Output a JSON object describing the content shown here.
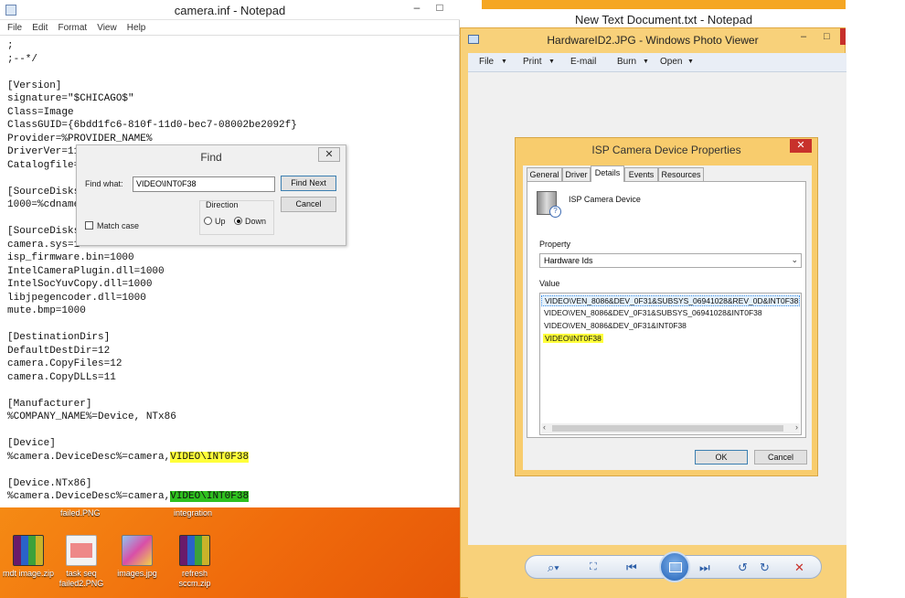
{
  "notepad": {
    "title": "camera.inf - Notepad",
    "menu": [
      "File",
      "Edit",
      "Format",
      "View",
      "Help"
    ],
    "lines": [
      ";",
      ";--*/",
      "",
      "[Version]",
      "signature=\"$CHICAGO$\"",
      "Class=Image",
      "ClassGUID={6bdd1fc6-810f-11d0-bec7-08002be2092f}",
      "Provider=%PROVIDER_NAME%",
      "DriverVer=11",
      "Catalogfile=",
      "",
      "[SourceDisks",
      "1000=%cdname",
      "",
      "[SourceDisks",
      "camera.sys=1",
      "isp_firmware.bin=1000",
      "IntelCameraPlugin.dll=1000",
      "IntelSocYuvCopy.dll=1000",
      "libjpegencoder.dll=1000",
      "mute.bmp=1000",
      "",
      "[DestinationDirs]",
      "DefaultDestDir=12",
      "camera.CopyFiles=12",
      "camera.CopyDLLs=11",
      "",
      "[Manufacturer]",
      "%COMPANY_NAME%=Device, NTx86",
      "",
      "[Device]"
    ],
    "device_line_prefix": "%camera.DeviceDesc%=camera,",
    "device_line_value": "VIDEO\\INT0F38",
    "blank": "",
    "ntx86_header": "[Device.NTx86]",
    "ntx86_line_prefix": "%camera.DeviceDesc%=camera,",
    "ntx86_line_value": "VIDEO\\INT0F38"
  },
  "find_dialog": {
    "title": "Find",
    "close": "✕",
    "find_what_label": "Find what:",
    "find_what_value": "VIDEO\\INT0F38",
    "find_next": "Find Next",
    "cancel": "Cancel",
    "direction_label": "Direction",
    "up": "Up",
    "down": "Down",
    "match_case": "Match case"
  },
  "background_notepad": {
    "title": "New Text Document.txt - Notepad"
  },
  "photo_viewer": {
    "title": "HardwareID2.JPG - Windows Photo Viewer",
    "toolbar": [
      "File",
      "Print",
      "E-mail",
      "Burn",
      "Open"
    ]
  },
  "properties": {
    "title": "ISP Camera Device Properties",
    "close": "✕",
    "tabs": [
      "General",
      "Driver",
      "Details",
      "Events",
      "Resources"
    ],
    "device_name": "ISP Camera Device",
    "property_label": "Property",
    "property_value": "Hardware Ids",
    "value_label": "Value",
    "values": [
      "VIDEO\\VEN_8086&DEV_0F31&SUBSYS_06941028&REV_0D&INT0F38",
      "VIDEO\\VEN_8086&DEV_0F31&SUBSYS_06941028&INT0F38",
      "VIDEO\\VEN_8086&DEV_0F31&INT0F38",
      "VIDEO\\INT0F38"
    ],
    "ok": "OK",
    "cancel": "Cancel"
  },
  "desktop": {
    "top_labels": [
      "failed.PNG",
      "integration"
    ],
    "icons": [
      {
        "label": "mdt image.zip",
        "icon": "winrar-archive-icon"
      },
      {
        "label": "task seq failed2.PNG",
        "icon": "png-image-icon"
      },
      {
        "label": "images.jpg",
        "icon": "jpg-image-icon"
      },
      {
        "label": "refresh sccm.zip",
        "icon": "winrar-archive-icon"
      }
    ]
  },
  "colors": {
    "highlight_yellow": "#ffff3a",
    "highlight_green": "#2fc11f",
    "desktop_orange": "#f06b0c",
    "window_frame": "#f8cc6d",
    "close_red": "#c8312b"
  }
}
